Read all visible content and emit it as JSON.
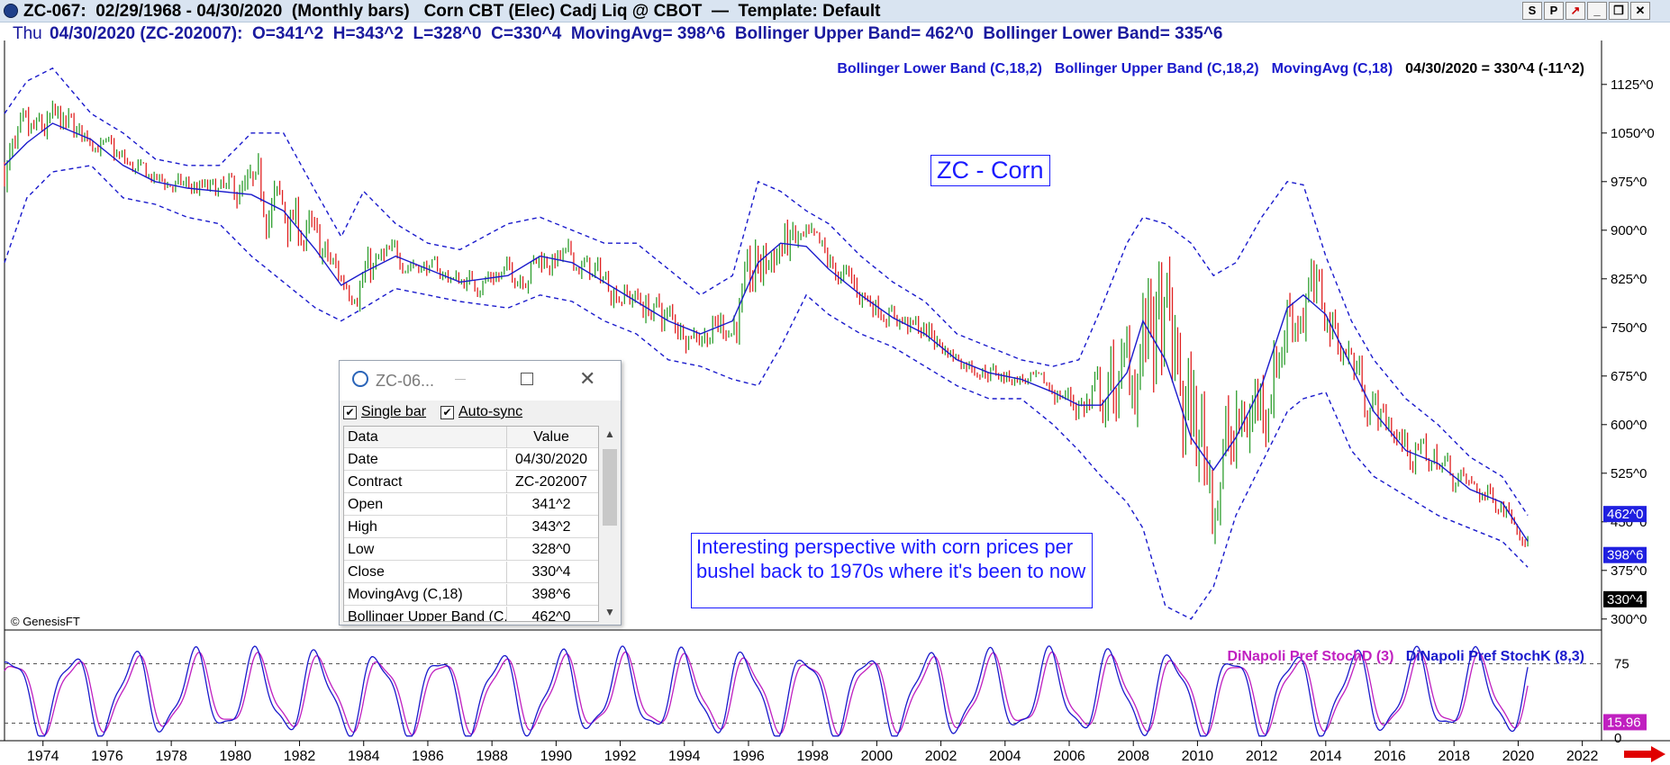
{
  "titlebar": {
    "title": "ZC-067:  02/29/1968 - 04/30/2020  (Monthly bars)   Corn CBT (Elec) Cadj Liq @ CBOT  —  Template: Default",
    "buttons": [
      "S",
      "P",
      "↗",
      "_",
      "❐",
      "✕"
    ]
  },
  "infobar": {
    "dow": "Thu",
    "values": "04/30/2020 (ZC-202007):  O=341^2  H=343^2  L=328^0  C=330^4  MovingAvg= 398^6  Bollinger Upper Band= 462^0  Bollinger Lower Band= 335^6"
  },
  "price_legend": {
    "lower": "Bollinger Lower Band (C,18,2)",
    "upper": "Bollinger Upper Band (C,18,2)",
    "ma": "MovingAvg (C,18)",
    "last": "04/30/2020 = 330^4 (-11^2)"
  },
  "annotations": {
    "corn_label": "ZC - Corn",
    "note": "Interesting perspective with corn prices per bushel back to 1970s where it's been to now",
    "copyright": "© GenesisFT"
  },
  "osc_legend": {
    "stochd": "DiNapoli Pref StochD (3)",
    "stochk": "DiNapoli Pref StochK (8,3)"
  },
  "colors": {
    "up_bar": "#2e9e2e",
    "down_bar": "#e02020",
    "band": "#1a1acc",
    "ma": "#1a1acc",
    "stochd": "#c020c0",
    "stochk": "#1a1acc",
    "upper_tag_bg": "#2020e0",
    "last_tag_bg": "#000000"
  },
  "data_window": {
    "title": "ZC-06...",
    "single_bar_label": "Single bar",
    "auto_sync_label": "Auto-sync",
    "header": [
      "Data",
      "Value"
    ],
    "rows": [
      [
        "Date",
        "04/30/2020"
      ],
      [
        "Contract",
        "ZC-202007"
      ],
      [
        "Open",
        "341^2"
      ],
      [
        "High",
        "343^2"
      ],
      [
        "Low",
        "328^0"
      ],
      [
        "Close",
        "330^4"
      ],
      [
        "MovingAvg (C,18)",
        "398^6"
      ],
      [
        "Bollinger Upper Band (C,",
        "462^0"
      ]
    ]
  },
  "chart_data": [
    {
      "type": "line",
      "x_ticks": [
        "1974",
        "1976",
        "1978",
        "1980",
        "1982",
        "1984",
        "1986",
        "1988",
        "1990",
        "1992",
        "1994",
        "1996",
        "1998",
        "2000",
        "2002",
        "2004",
        "2006",
        "2008",
        "2010",
        "2012",
        "2014",
        "2016",
        "2018",
        "2020",
        "2022"
      ],
      "y_ticks": [
        "1125^0",
        "1050^0",
        "975^0",
        "900^0",
        "825^0",
        "750^0",
        "675^0",
        "600^0",
        "525^0",
        "450^0",
        "375^0",
        "300^0"
      ],
      "y_tick_values": [
        1125,
        1050,
        975,
        900,
        825,
        750,
        675,
        600,
        525,
        450,
        375,
        300
      ],
      "ylim": [
        290,
        1165
      ],
      "xlim": [
        1972.8,
        2022.6
      ],
      "price_tags": [
        {
          "label": "462^0",
          "value": 462,
          "kind": "upper"
        },
        {
          "label": "398^6",
          "value": 398.75,
          "kind": "ma"
        },
        {
          "label": "330^4",
          "value": 330.5,
          "kind": "last"
        }
      ],
      "series": [
        {
          "name": "MovingAvg (C,18)",
          "x": [
            1972.8,
            1973.5,
            1974.3,
            1975.5,
            1976.5,
            1977.5,
            1978.5,
            1979.5,
            1980.5,
            1981.5,
            1982.5,
            1983.3,
            1984,
            1985,
            1986,
            1987,
            1988.5,
            1989.5,
            1990.5,
            1991.5,
            1992.5,
            1993.5,
            1994.5,
            1995.5,
            1996.3,
            1997,
            1997.8,
            1998.5,
            1999.5,
            2000.5,
            2001.5,
            2002.5,
            2003.5,
            2004.5,
            2005.5,
            2006.3,
            2007,
            2007.8,
            2008.3,
            2009,
            2009.8,
            2010.5,
            2011.2,
            2012,
            2012.8,
            2013.3,
            2014,
            2014.8,
            2015.5,
            2016.5,
            2017.5,
            2018.5,
            2019.5,
            2020.3
          ],
          "y": [
            1000,
            1035,
            1065,
            1040,
            1000,
            975,
            965,
            960,
            955,
            930,
            870,
            815,
            835,
            860,
            840,
            820,
            830,
            860,
            850,
            820,
            790,
            760,
            740,
            760,
            850,
            880,
            875,
            840,
            800,
            765,
            740,
            700,
            680,
            670,
            650,
            630,
            630,
            680,
            760,
            700,
            580,
            530,
            580,
            660,
            780,
            800,
            770,
            690,
            620,
            560,
            540,
            500,
            480,
            420
          ]
        },
        {
          "name": "Bollinger Upper Band (C,18,2)",
          "x": [
            1972.8,
            1973.5,
            1974.3,
            1975.5,
            1976.5,
            1977.5,
            1978.5,
            1979.5,
            1980.5,
            1981.5,
            1982.5,
            1983.3,
            1984,
            1985,
            1986,
            1987,
            1988.5,
            1989.5,
            1990.5,
            1991.5,
            1992.5,
            1993.5,
            1994.5,
            1995.5,
            1996.3,
            1997,
            1997.8,
            1998.5,
            1999.5,
            2000.5,
            2001.5,
            2002.5,
            2003.5,
            2004.5,
            2005.5,
            2006.3,
            2007,
            2007.8,
            2008.3,
            2009,
            2009.8,
            2010.5,
            2011.2,
            2012,
            2012.8,
            2013.3,
            2014,
            2014.8,
            2015.5,
            2016.5,
            2017.5,
            2018.5,
            2019.5,
            2020.3
          ],
          "y": [
            1080,
            1130,
            1150,
            1080,
            1050,
            1010,
            1000,
            1000,
            1050,
            1050,
            960,
            890,
            960,
            910,
            880,
            870,
            910,
            920,
            900,
            880,
            880,
            840,
            800,
            830,
            975,
            960,
            930,
            910,
            860,
            820,
            790,
            740,
            720,
            700,
            690,
            700,
            780,
            880,
            920,
            910,
            880,
            830,
            850,
            920,
            975,
            970,
            860,
            760,
            700,
            640,
            600,
            550,
            520,
            460
          ]
        },
        {
          "name": "Bollinger Lower Band (C,18,2)",
          "x": [
            1972.8,
            1973.5,
            1974.3,
            1975.5,
            1976.5,
            1977.5,
            1978.5,
            1979.5,
            1980.5,
            1981.5,
            1982.5,
            1983.3,
            1984,
            1985,
            1986,
            1987,
            1988.5,
            1989.5,
            1990.5,
            1991.5,
            1992.5,
            1993.5,
            1994.5,
            1995.5,
            1996.3,
            1997,
            1997.8,
            1998.5,
            1999.5,
            2000.5,
            2001.5,
            2002.5,
            2003.5,
            2004.5,
            2005.5,
            2006.3,
            2007,
            2007.8,
            2008.3,
            2009,
            2009.8,
            2010.5,
            2011.2,
            2012,
            2012.8,
            2013.3,
            2014,
            2014.8,
            2015.5,
            2016.5,
            2017.5,
            2018.5,
            2019.5,
            2020.3
          ],
          "y": [
            850,
            950,
            990,
            1000,
            950,
            940,
            920,
            910,
            860,
            820,
            780,
            760,
            780,
            810,
            800,
            790,
            780,
            800,
            790,
            760,
            740,
            700,
            690,
            670,
            660,
            720,
            800,
            770,
            740,
            720,
            690,
            660,
            640,
            640,
            600,
            560,
            520,
            480,
            440,
            320,
            300,
            350,
            460,
            540,
            620,
            640,
            650,
            560,
            520,
            490,
            460,
            440,
            420,
            380
          ]
        }
      ]
    },
    {
      "type": "line",
      "ylim": [
        0,
        100
      ],
      "y_ticks": [
        "75",
        "0"
      ],
      "y_tick_values": [
        75,
        0
      ],
      "reference_lines": [
        75,
        15
      ],
      "price_tags": [
        {
          "label": "15.96",
          "value": 15.96
        }
      ],
      "series": [
        {
          "name": "DiNapoli Pref StochD (3)"
        },
        {
          "name": "DiNapoli Pref StochK (8,3)"
        }
      ]
    }
  ]
}
